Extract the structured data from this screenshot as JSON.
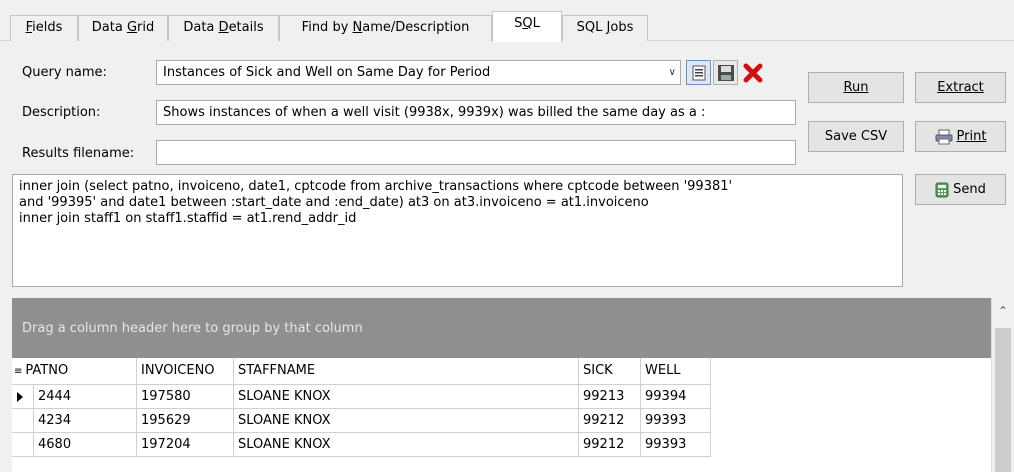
{
  "tabs": {
    "fields": "Fields",
    "data_grid": "Data Grid",
    "data_details": "Data Details",
    "find": "Find by Name/Description",
    "sql": "SQL",
    "sql_jobs": "SQL Jobs"
  },
  "form": {
    "query_name_label": "Query name:",
    "query_name_value": "Instances of Sick and Well on Same Day for Period",
    "description_label": "Description:",
    "description_value": "Shows instances of when a well visit (9938x, 9939x) was billed the same day as a :",
    "results_label": "Results filename:",
    "results_value": ""
  },
  "buttons": {
    "run": "Run",
    "extract": "Extract",
    "save_csv": "Save CSV",
    "print": "Print",
    "send": "Send"
  },
  "sql_lines": [
    "inner join (select patno, invoiceno, date1, cptcode from archive_transactions where cptcode between '99381'",
    "and '99395' and date1 between :start_date and :end_date) at3 on at3.invoiceno = at1.invoiceno",
    "inner join staff1 on staff1.staffid = at1.rend_addr_id"
  ],
  "grid": {
    "group_hint": "Drag a column header here to group by that column",
    "columns": [
      "PATNO",
      "INVOICENO",
      "STAFFNAME",
      "SICK",
      "WELL"
    ],
    "rows": [
      [
        "2444",
        "197580",
        "SLOANE KNOX",
        "99213",
        "99394"
      ],
      [
        "4234",
        "195629",
        "SLOANE KNOX",
        "99212",
        "99393"
      ],
      [
        "4680",
        "197204",
        "SLOANE KNOX",
        "99212",
        "99393"
      ]
    ]
  }
}
